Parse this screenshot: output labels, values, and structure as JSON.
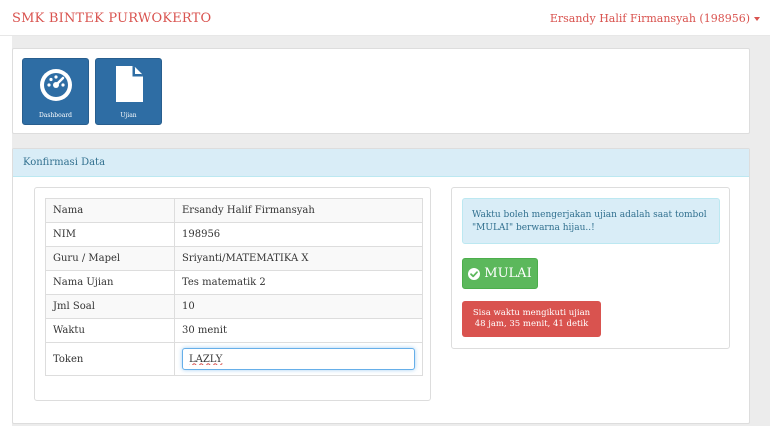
{
  "navbar": {
    "brand": "SMK BINTEK PURWOKERTO",
    "user": "Ersandy Halif Firmansyah (198956)"
  },
  "tiles": [
    {
      "label": "Dashboard",
      "icon": "dashboard-icon"
    },
    {
      "label": "Ujian",
      "icon": "document-icon"
    }
  ],
  "konfirmasi": {
    "title": "Konfirmasi Data",
    "rows": [
      {
        "label": "Nama",
        "value": "Ersandy Halif Firmansyah"
      },
      {
        "label": "NIM",
        "value": "198956"
      },
      {
        "label": "Guru / Mapel",
        "value": "Sriyanti/MATEMATIKA X"
      },
      {
        "label": "Nama Ujian",
        "value": "Tes matematik 2"
      },
      {
        "label": "Jml Soal",
        "value": "10"
      },
      {
        "label": "Waktu",
        "value": "30 menit"
      }
    ],
    "token_label": "Token",
    "token_value": "LAZLY"
  },
  "side": {
    "info": "Waktu boleh mengerjakan ujian adalah saat tombol \"MULAI\" berwarna hijau..!",
    "mulai_label": "MULAI",
    "timer_line1": "Sisa waktu mengikuti ujian",
    "timer_line2": "48 jam, 35 menit, 41 detik"
  },
  "colors": {
    "brand": "#d9534f",
    "tile": "#2e6da4",
    "success": "#5cb85c",
    "danger": "#d9534f",
    "info_bg": "#d9edf7"
  }
}
